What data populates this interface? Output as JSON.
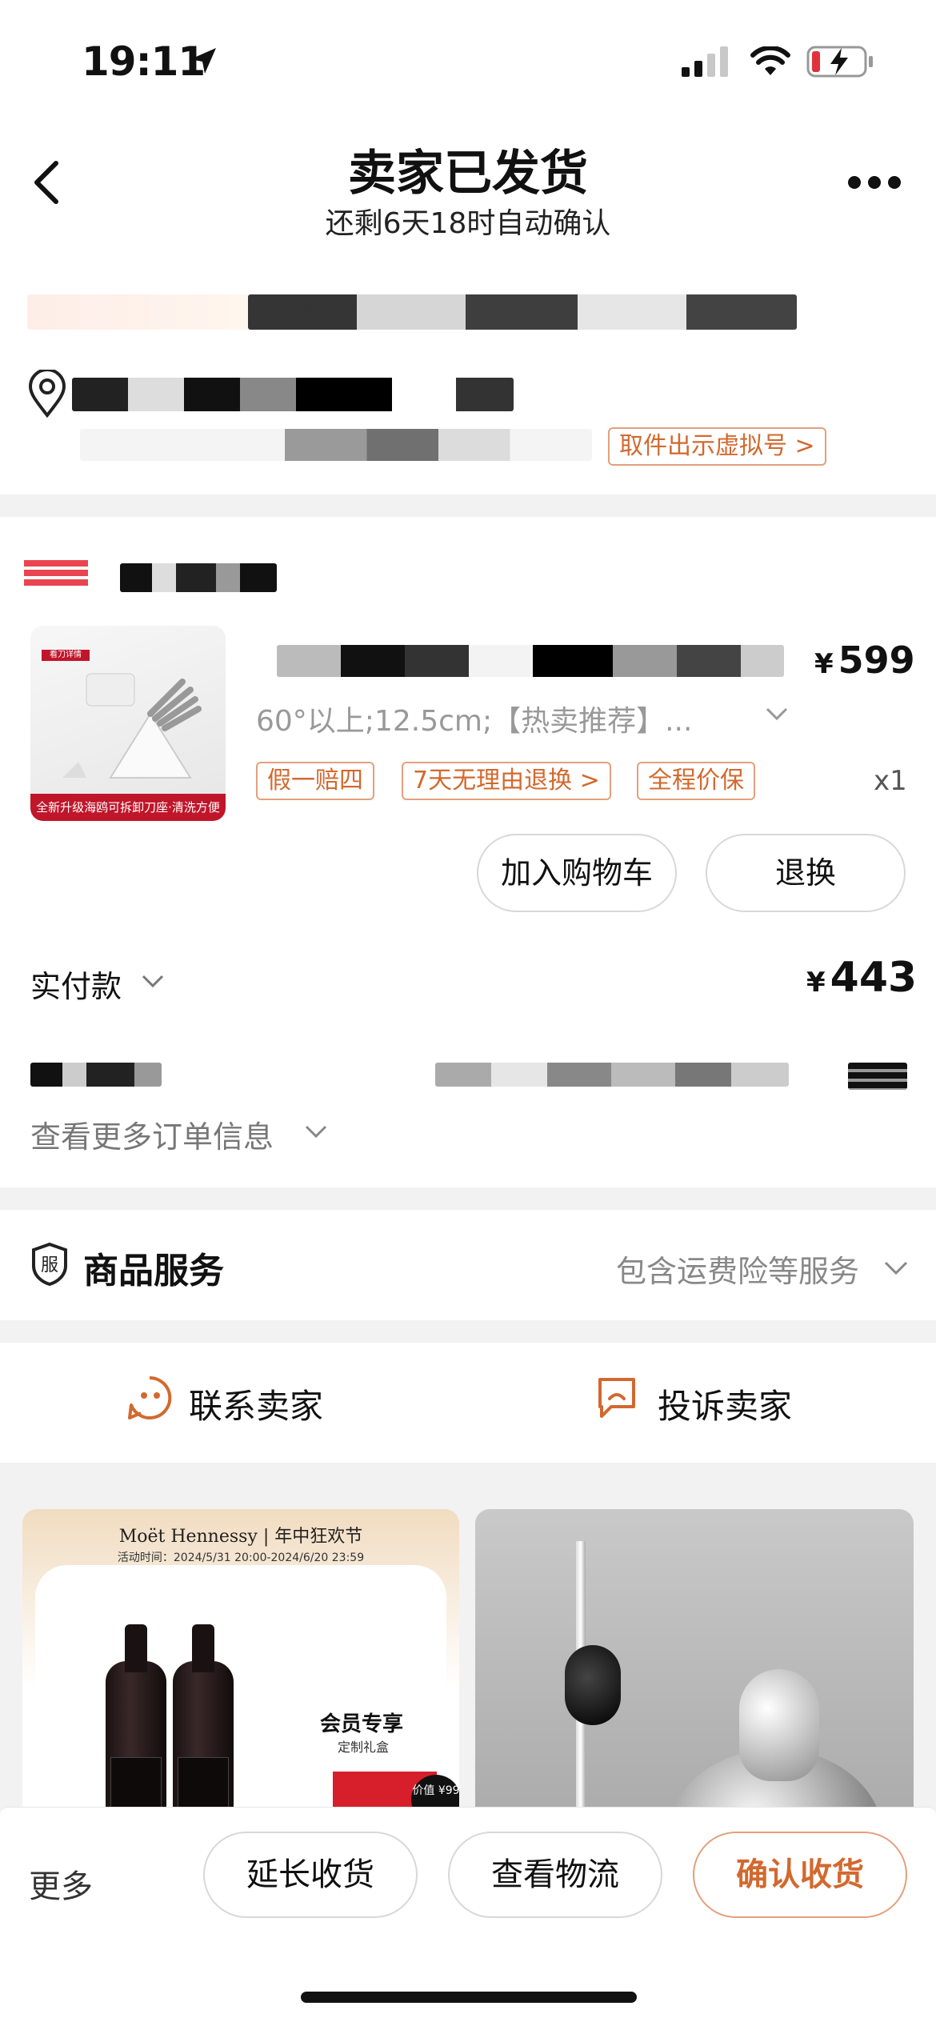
{
  "status_bar": {
    "time": "19:11"
  },
  "header": {
    "title": "卖家已发货",
    "subtitle": "还剩6天18时自动确认"
  },
  "address": {
    "pickup_tag": "取件出示虚拟号 >"
  },
  "order": {
    "product": {
      "thumb_header": "看刀详情",
      "thumb_band": "全新升级海鸥可拆卸刀座·清洗方便",
      "price_symbol": "¥",
      "price": "599",
      "sku": "60°以上;12.5cm;【热卖推荐】...",
      "tags": [
        "假一赔四",
        "7天无理由退换 >",
        "全程价保"
      ],
      "quantity": "x1"
    },
    "actions": {
      "add_to_cart": "加入购物车",
      "return_exchange": "退换"
    },
    "paid": {
      "label": "实付款",
      "symbol": "¥",
      "amount": "443"
    },
    "more_info": "查看更多订单信息"
  },
  "service": {
    "title": "商品服务",
    "summary": "包含运费险等服务"
  },
  "contact": {
    "contact_seller": "联系卖家",
    "complain_seller": "投诉卖家"
  },
  "recommend": {
    "card1": {
      "brand": "Moët Hennessy | 年中狂欢节",
      "date": "活动时间：2024/5/31 20:00-2024/6/20 23:59",
      "member": "会员专享",
      "member_sub": "定制礼盒",
      "value_badge": "价值 ¥99"
    }
  },
  "bottom_bar": {
    "more": "更多",
    "extend": "延长收货",
    "logistics": "查看物流",
    "confirm": "确认收货"
  },
  "colors": {
    "accent": "#d2692f",
    "accent_border": "#e3a07c",
    "shop_red": "#e94550"
  }
}
